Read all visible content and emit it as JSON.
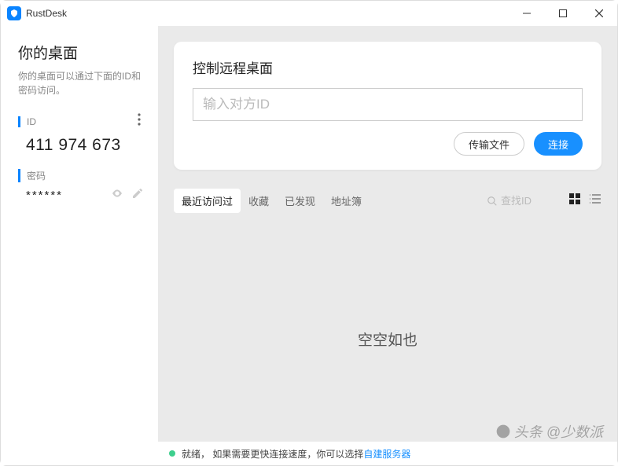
{
  "titlebar": {
    "title": "RustDesk"
  },
  "sidebar": {
    "heading": "你的桌面",
    "description": "你的桌面可以通过下面的ID和密码访问。",
    "id_label": "ID",
    "id_value": "411 974 673",
    "password_label": "密码",
    "password_value": "******"
  },
  "connect_card": {
    "heading": "控制远程桌面",
    "placeholder": "输入对方ID",
    "transfer_label": "传输文件",
    "connect_label": "连接"
  },
  "tabs": {
    "recent": "最近访问过",
    "favorites": "收藏",
    "discovered": "已发现",
    "addressbook": "地址簿"
  },
  "search": {
    "placeholder": "查找ID"
  },
  "empty": {
    "text": "空空如也"
  },
  "status": {
    "ready": "就绪，",
    "hint_prefix": "如果需要更快连接速度，你可以选择",
    "hint_link": "自建服务器"
  },
  "watermark": {
    "text": "头条 @少数派"
  }
}
